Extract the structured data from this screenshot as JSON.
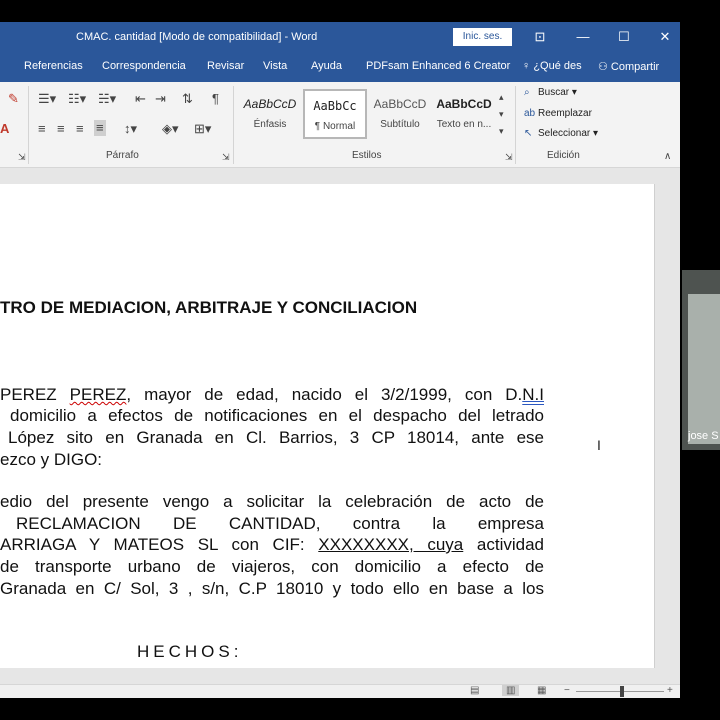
{
  "window": {
    "title": "CMAC. cantidad [Modo de compatibilidad]  -  Word",
    "signin_label": "Inic. ses.",
    "controls": [
      "⊡",
      "—",
      "☐",
      "✕"
    ]
  },
  "tabs": [
    "Referencias",
    "Correspondencia",
    "Revisar",
    "Vista",
    "Ayuda",
    "PDFsam Enhanced 6 Creator",
    "¿Qué des",
    "Compartir"
  ],
  "ribbon": {
    "groups": {
      "paragraph": "Párrafo",
      "styles": "Estilos",
      "editing": "Edición"
    },
    "styles": [
      {
        "preview": "AaBbCcD",
        "name": "Énfasis"
      },
      {
        "preview": "AaBbCc",
        "name": "¶ Normal"
      },
      {
        "preview": "AaBbCcD",
        "name": "Subtítulo"
      },
      {
        "preview": "AaBbCcD",
        "name": "Texto en n..."
      }
    ],
    "editing": {
      "find": "Buscar",
      "replace": "Reemplazar",
      "select": "Seleccionar"
    }
  },
  "document": {
    "heading": "TRO DE MEDIACION, ARBITRAJE Y CONCILIACION",
    "p1": {
      "l1": {
        "a": "PEREZ",
        "b": "PEREZ",
        "c": ", mayor de edad, nacido el 3/2/1999, con D.",
        "d": "N.I"
      },
      "l2": "domicilio a efectos de notificaciones en el despacho del letrado",
      "l3": "López sito en Granada en Cl. Barrios, 3 CP 18014, ante ese",
      "l4": "ezco y DIGO:"
    },
    "p2": {
      "l1": "edio del presente vengo a solicitar la celebración de acto de",
      "l2": "RECLAMACION  DE  CANTIDAD,  contra  la  empresa",
      "l3": {
        "a": "ARRIAGA Y MATEOS SL con CIF: ",
        "b": "XXXXXXXX,  cuya",
        "c": " actividad"
      },
      "l4": "de transporte urbano de viajeros, con domicilio a efecto de",
      "l5": "Granada en C/ Sol, 3 , s/n, C.P 18010 y todo ello en base a los"
    },
    "hechos": "HECHOS:"
  },
  "video": {
    "participant": "jose S"
  },
  "colors": {
    "accent": "#2b579a",
    "ribbon": "#f3f3f3",
    "workspace": "#e6e6e6"
  }
}
